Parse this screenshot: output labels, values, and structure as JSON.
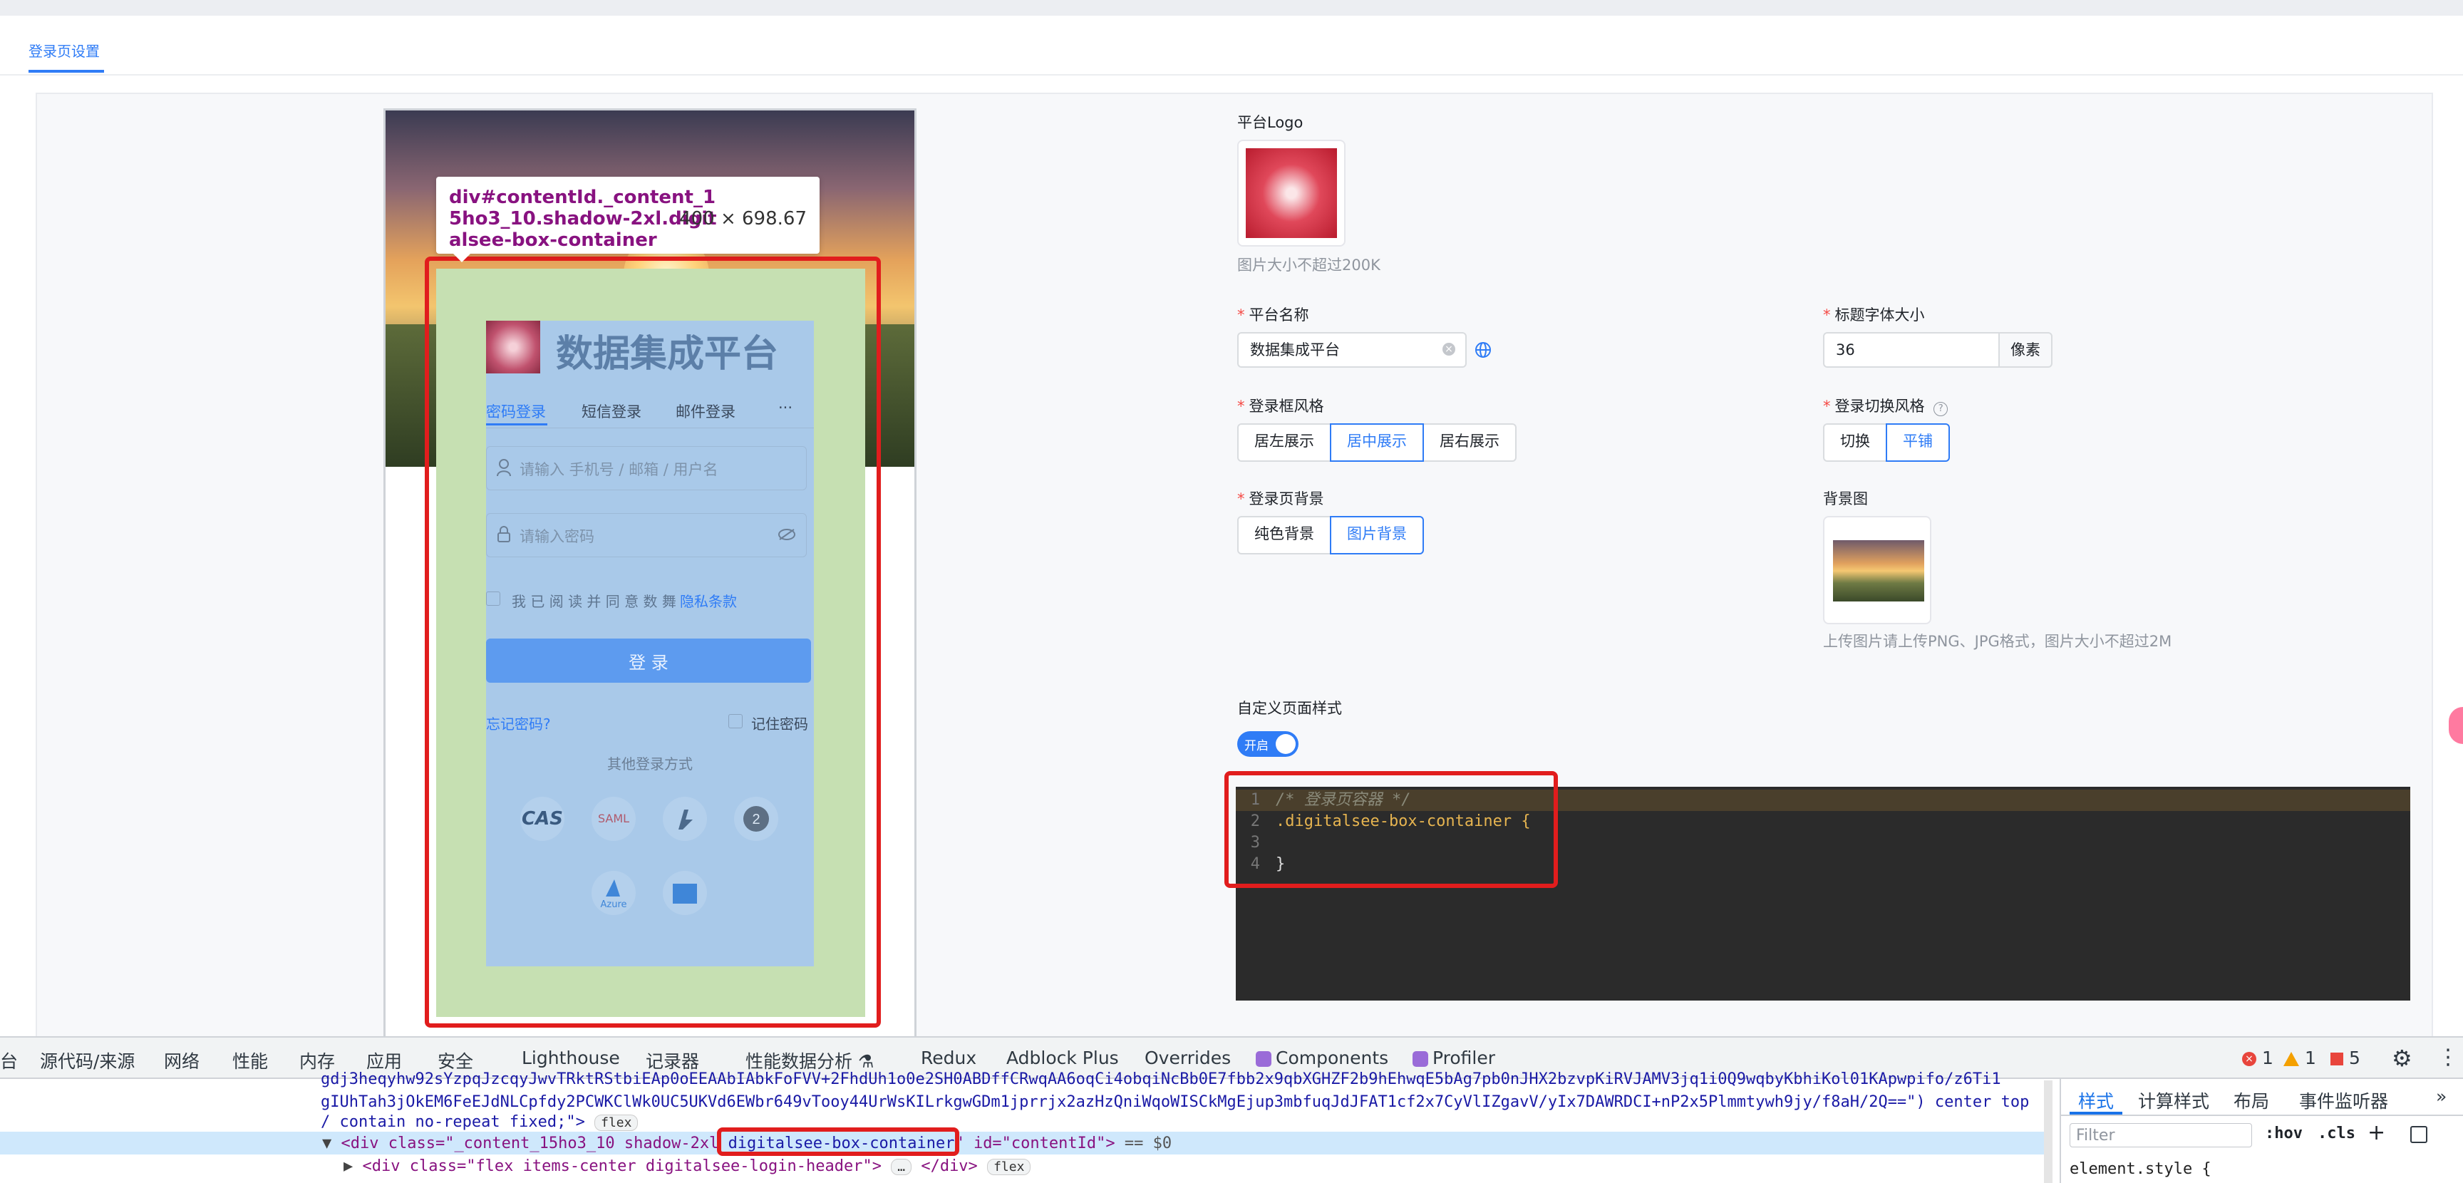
{
  "tabs": {
    "active": "登录页设置"
  },
  "preview": {
    "tooltip": {
      "selector": "div#contentId._content_15ho3_10.shadow-2xl.digitalsee-box-container",
      "size": "400 × 698.67"
    },
    "login": {
      "title": "数据集成平台",
      "tabs": [
        "密码登录",
        "短信登录",
        "邮件登录",
        "···"
      ],
      "account_placeholder": "请输入 手机号 / 邮箱 / 用户名",
      "password_placeholder": "请输入密码",
      "agree_text": "我 已 阅 读 并 同 意 数 舞",
      "privacy_link": "隐私条款",
      "login_button": "登 录",
      "forgot": "忘记密码?",
      "remember": "记住密码",
      "other_login": "其他登录方式",
      "providers": [
        "CAS",
        "SAML",
        "",
        "",
        "Azure",
        ""
      ]
    }
  },
  "form": {
    "logo_label": "平台Logo",
    "logo_hint": "图片大小不超过200K",
    "platform_name_label": "平台名称",
    "platform_name_value": "数据集成平台",
    "title_font_label": "标题字体大小",
    "title_font_value": "36",
    "title_font_unit": "像素",
    "box_style_label": "登录框风格",
    "box_style_options": [
      "居左展示",
      "居中展示",
      "居右展示"
    ],
    "switch_style_label": "登录切换风格",
    "switch_style_options": [
      "切换",
      "平铺"
    ],
    "bg_label": "登录页背景",
    "bg_options": [
      "纯色背景",
      "图片背景"
    ],
    "bg_image_label": "背景图",
    "bg_hint": "上传图片请上传PNG、JPG格式，图片大小不超过2M",
    "custom_style_label": "自定义页面样式",
    "toggle_label": "开启",
    "code": [
      {
        "n": "1",
        "text": "/* 登录页容器 */"
      },
      {
        "n": "2",
        "text": ".digitalsee-box-container {"
      },
      {
        "n": "3",
        "text": ""
      },
      {
        "n": "4",
        "text": "}"
      }
    ]
  },
  "devtools": {
    "tabs": [
      "台",
      "源代码/来源",
      "网络",
      "性能",
      "内存",
      "应用",
      "安全",
      "Lighthouse",
      "记录器",
      "性能数据分析 ⚗",
      "Redux",
      "Adblock Plus",
      "Overrides",
      "Components",
      "Profiler"
    ],
    "counts": {
      "errors": "1",
      "warnings": "1",
      "issues": "5"
    },
    "side_tabs": [
      "样式",
      "计算样式",
      "布局",
      "事件监听器",
      "»"
    ],
    "filter_placeholder": "Filter",
    "hov": ":hov",
    "cls": ".cls",
    "element_style": "element.style {",
    "lines": {
      "l1": "gdj3heqyhw92sYzpqJzcqyJwvTRktRStbiEAp0oEEAAbIAbkFoFVV+2FhdUh1o0e2SH0ABDffCRwqAA6oqCi4obqiNcBb0E7fbb2x9qbXGHZF2b9hEhwqE5bAg7pb0nJHX2bzvpKiRVJAMV3jq1i0Q9wqbyKbhiKol01KApwpifo/z6Ti1",
      "l2": "gIUhTah3jOkEM6FeEJdNLCpfdy2PCWKClWk0UC5UKVd6EWbr649vTooy44UrWsKILrkgwGDm1jprrjx2azHzQniWqoWISCkMgEjup3mbfuqJdJFAT1cf2x7CyVlIZgavV/yIx7DAWRDCI+nP2x5Plmmtywh9jy/f8aH/2Q==\") center top",
      "l3": "/ contain no-repeat fixed;\">",
      "l3_badge": "flex",
      "l4_open": "<div class=\"_content_15ho3_10 shadow-2xl ",
      "l4_hl": "digitalsee-box-container",
      "l4_close": "\" id=\"contentId\">",
      "l4_tail": " == $0",
      "l5_a": "<div class=\"flex items-center digitalsee-login-header\">",
      "l5_dots": "…",
      "l5_b": "</div>",
      "l5_badge": "flex"
    }
  }
}
